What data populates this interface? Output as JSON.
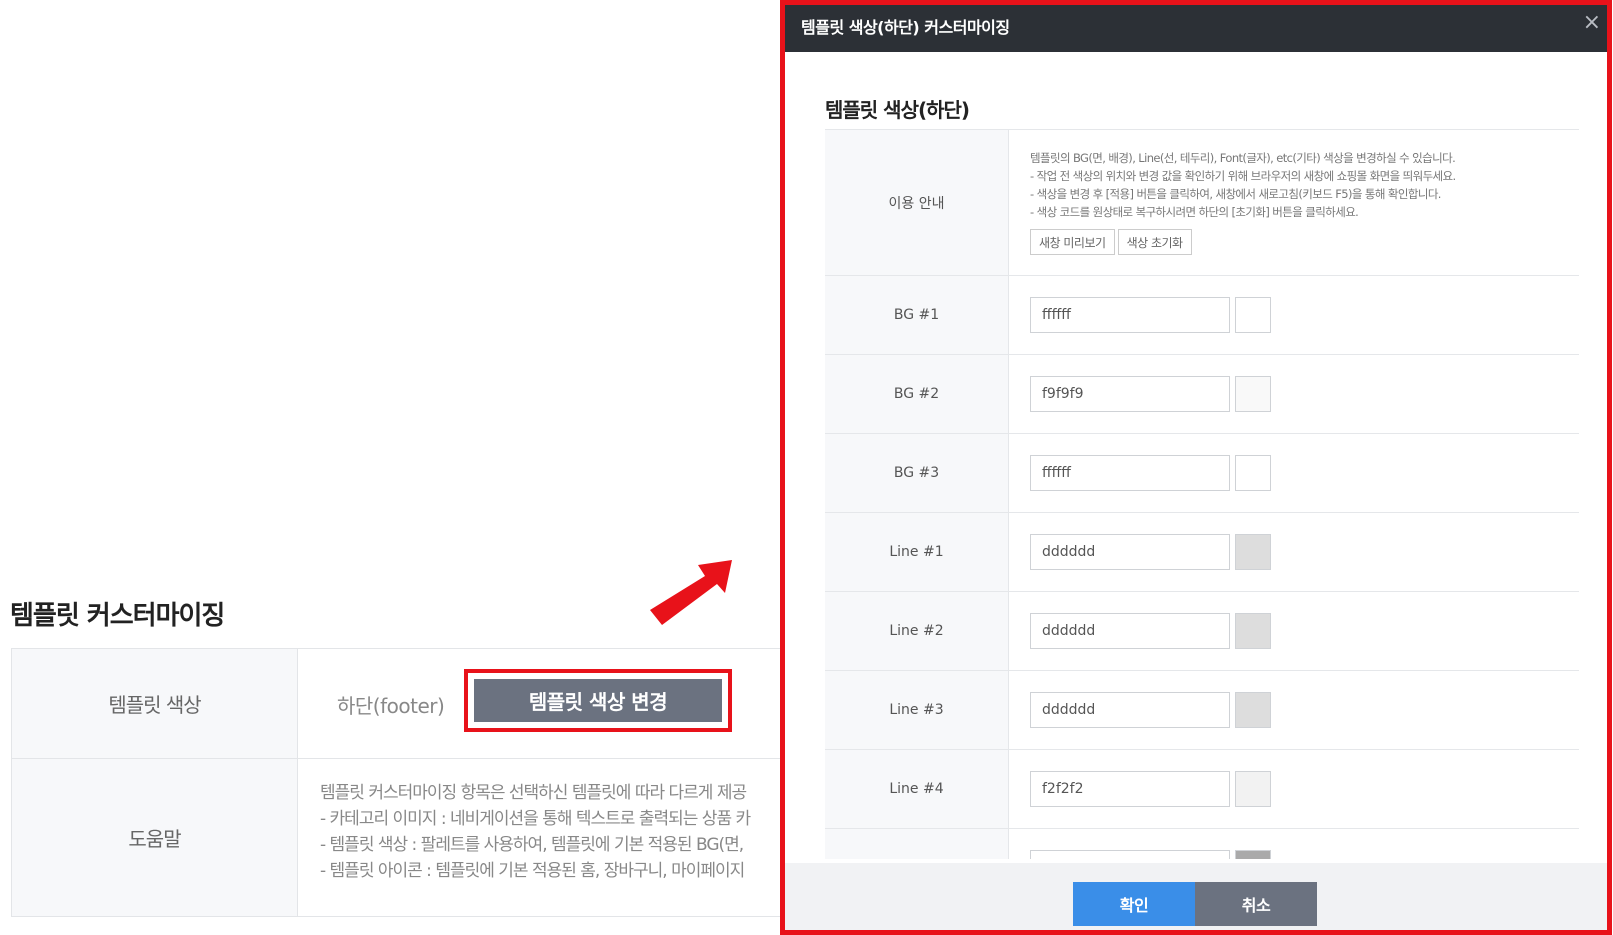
{
  "page": {
    "title": "템플릿 커스터마이징",
    "color_row": {
      "label": "템플릿 색상",
      "target": "하단(footer)",
      "change_button": "템플릿 색상 변경"
    },
    "help_row": {
      "label": "도움말",
      "lines": [
        "템플릿 커스터마이징 항목은 선택하신 템플릿에 따라 다르게 제공",
        "- 카테고리 이미지 : 네비게이션을 통해 텍스트로 출력되는 상품 카",
        "- 템플릿 색상 : 팔레트를 사용하여, 템플릿에 기본 적용된 BG(면,",
        "- 템플릿 아이콘 : 템플릿에 기본 적용된 홈, 장바구니, 마이페이지"
      ]
    }
  },
  "modal": {
    "title": "템플릿 색상(하단) 커스터마이징",
    "close_glyph": "×",
    "section_title": "템플릿 색상(하단)",
    "guide": {
      "label": "이용 안내",
      "lines": [
        "템플릿의 BG(면, 배경), Line(선, 테두리), Font(글자), etc(기타) 색상을 변경하실 수 있습니다.",
        "- 작업 전 색상의 위치와 변경 값을 확인하기 위해 브라우저의 새창에 쇼핑몰 화면을 띄워두세요.",
        "- 색상을 변경 후 [적용] 버튼을 클릭하여, 새창에서 새로고침(키보드 F5)을 통해 확인합니다.",
        "- 색상 코드를 원상태로 복구하시려면 하단의 [초기화] 버튼을 클릭하세요."
      ],
      "preview_button": "새창 미리보기",
      "reset_button": "색상 초기화"
    },
    "colors": [
      {
        "label": "BG #1",
        "value": "ffffff",
        "swatch": "#ffffff"
      },
      {
        "label": "BG #2",
        "value": "f9f9f9",
        "swatch": "#f9f9f9"
      },
      {
        "label": "BG #3",
        "value": "ffffff",
        "swatch": "#ffffff"
      },
      {
        "label": "Line #1",
        "value": "dddddd",
        "swatch": "#dddddd"
      },
      {
        "label": "Line #2",
        "value": "dddddd",
        "swatch": "#dddddd"
      },
      {
        "label": "Line #3",
        "value": "dddddd",
        "swatch": "#dddddd"
      },
      {
        "label": "Line #4",
        "value": "f2f2f2",
        "swatch": "#f2f2f2"
      },
      {
        "label": "",
        "value": "",
        "swatch": "#aaaaaa"
      }
    ],
    "ok_button": "확인",
    "cancel_button": "취소"
  },
  "colors": {
    "highlight": "#e8121a",
    "header_bg": "#2c3036",
    "primary": "#3a8ee8",
    "secondary": "#6b7280"
  }
}
